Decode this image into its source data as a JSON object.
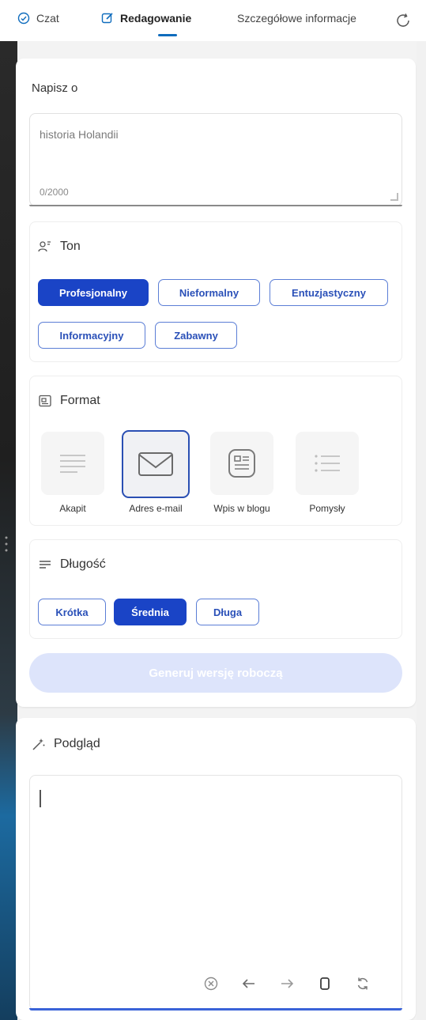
{
  "tabs": {
    "chat": "Czat",
    "compose": "Redagowanie",
    "insights": "Szczegółowe informacje"
  },
  "write": {
    "label": "Napisz o",
    "value": "historia Holandii",
    "counter": "0/2000"
  },
  "tone": {
    "title": "Ton",
    "options": [
      "Profesjonalny",
      "Nieformalny",
      "Entuzjastyczny",
      "Informacyjny",
      "Zabawny"
    ],
    "selected": "Profesjonalny"
  },
  "format": {
    "title": "Format",
    "options": [
      "Akapit",
      "Adres e-mail",
      "Wpis w blogu",
      "Pomysły"
    ],
    "selected": "Adres e-mail"
  },
  "length": {
    "title": "Długość",
    "options": [
      "Krótka",
      "Średnia",
      "Długa"
    ],
    "selected": "Średnia"
  },
  "generate_label": "Generuj wersję roboczą",
  "preview": {
    "title": "Podgląd",
    "content": ""
  },
  "colors": {
    "accent": "#1a44c6",
    "tab_underline": "#0f6cbd",
    "disabled_button": "#dde4fb"
  },
  "icons": [
    "chat-icon",
    "compose-icon",
    "refresh-icon",
    "tone-icon",
    "format-icon",
    "length-icon",
    "sparkle-icon",
    "stop-icon",
    "back-arrow-icon",
    "forward-arrow-icon",
    "copy-icon",
    "regenerate-icon"
  ]
}
